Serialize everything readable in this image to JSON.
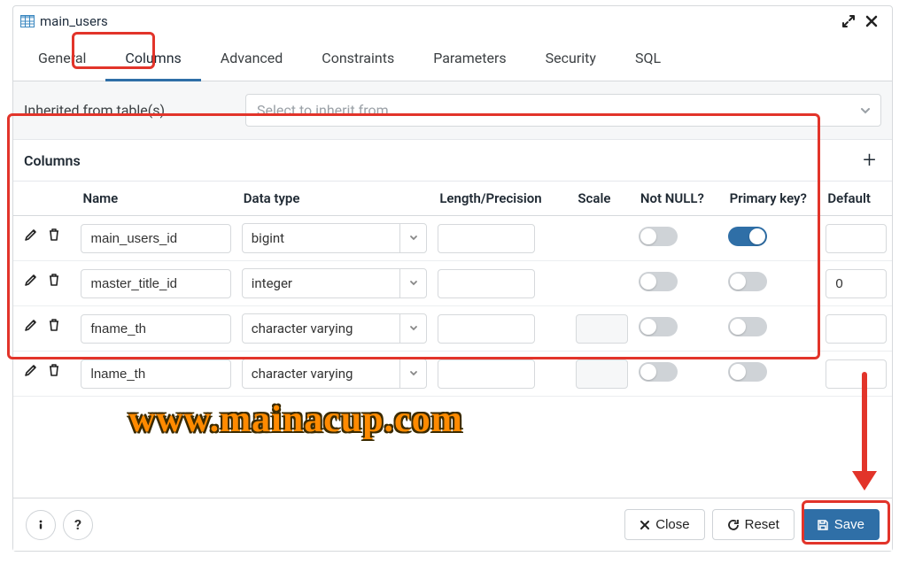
{
  "header": {
    "title": "main_users"
  },
  "tabs": {
    "items": [
      "General",
      "Columns",
      "Advanced",
      "Constraints",
      "Parameters",
      "Security",
      "SQL"
    ],
    "active_index": 1
  },
  "inherit": {
    "label": "Inherited from table(s)",
    "placeholder": "Select to inherit from..."
  },
  "columns_section": {
    "title": "Columns",
    "headers": [
      "Name",
      "Data type",
      "Length/Precision",
      "Scale",
      "Not NULL?",
      "Primary key?",
      "Default"
    ],
    "rows": [
      {
        "name": "main_users_id",
        "data_type": "bigint",
        "length": "",
        "scale": "",
        "not_null": false,
        "primary_key": true,
        "default": "",
        "scale_editable": false
      },
      {
        "name": "master_title_id",
        "data_type": "integer",
        "length": "",
        "scale": "",
        "not_null": false,
        "primary_key": false,
        "default": "0",
        "scale_editable": false
      },
      {
        "name": "fname_th",
        "data_type": "character varying",
        "length": "",
        "scale": "",
        "not_null": false,
        "primary_key": false,
        "default": "",
        "scale_editable": true
      },
      {
        "name": "lname_th",
        "data_type": "character varying",
        "length": "",
        "scale": "",
        "not_null": false,
        "primary_key": false,
        "default": "",
        "scale_editable": true
      }
    ]
  },
  "footer": {
    "close": "Close",
    "reset": "Reset",
    "save": "Save"
  },
  "watermark": "www.mainacup.com"
}
